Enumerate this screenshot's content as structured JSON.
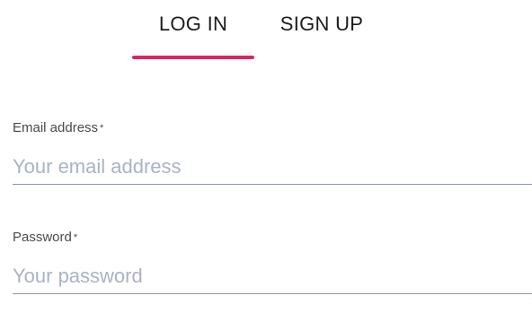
{
  "tabs": [
    {
      "label": "LOG IN",
      "active": true
    },
    {
      "label": "SIGN UP",
      "active": false
    }
  ],
  "colors": {
    "accent": "#e0245e",
    "underline": "#8a93b3",
    "placeholder": "#a9b2c8"
  },
  "form": {
    "email": {
      "label": "Email address",
      "required_mark": "*",
      "placeholder": "Your email address",
      "value": ""
    },
    "password": {
      "label": "Password",
      "required_mark": "*",
      "placeholder": "Your password",
      "value": ""
    }
  }
}
